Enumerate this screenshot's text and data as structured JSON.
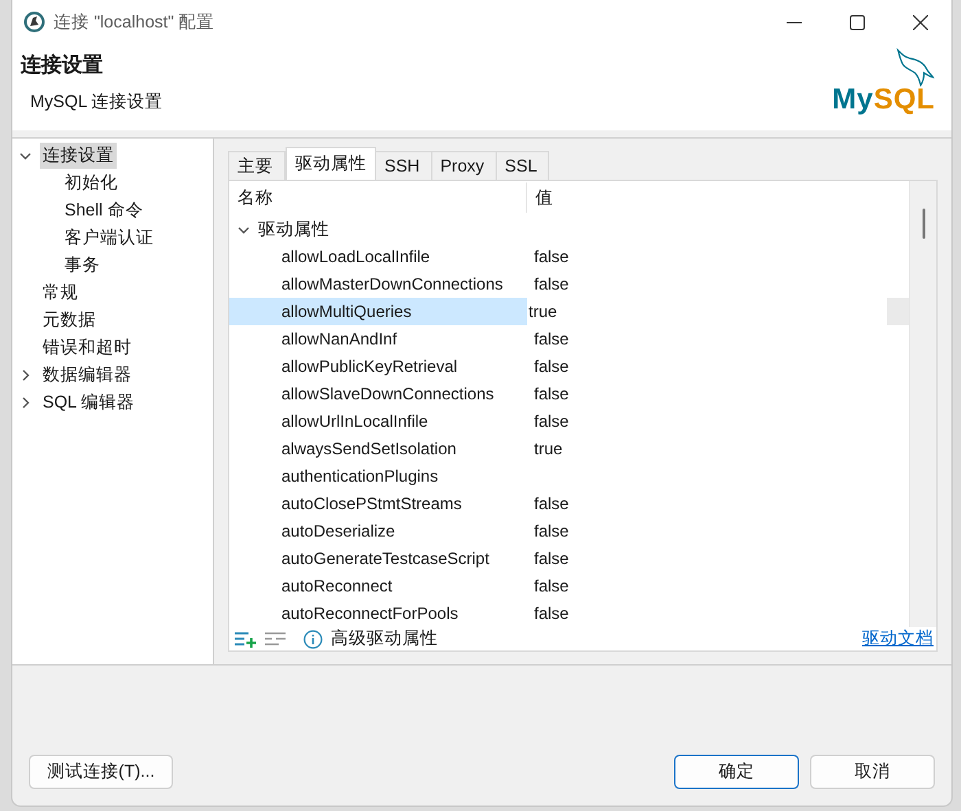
{
  "window": {
    "title": "连接 \"localhost\" 配置"
  },
  "header": {
    "title": "连接设置",
    "subtitle": "MySQL 连接设置",
    "logo": [
      "My",
      "SQL"
    ]
  },
  "sidebar": {
    "items": [
      {
        "label": "连接设置",
        "selected": true,
        "expanded": true,
        "children": [
          {
            "label": "初始化",
            "selected": false
          },
          {
            "label": "Shell 命令",
            "selected": false
          },
          {
            "label": "客户端认证",
            "selected": false
          },
          {
            "label": "事务",
            "selected": false
          }
        ]
      },
      {
        "label": "常规",
        "selected": false
      },
      {
        "label": "元数据",
        "selected": false
      },
      {
        "label": "错误和超时",
        "selected": false
      },
      {
        "label": "数据编辑器",
        "selected": false,
        "expanded": false
      },
      {
        "label": "SQL 编辑器",
        "selected": false,
        "expanded": false
      }
    ]
  },
  "tabs": [
    {
      "label": "主要",
      "selected": false
    },
    {
      "label": "驱动属性",
      "selected": true
    },
    {
      "label": "SSH",
      "selected": false
    },
    {
      "label": "Proxy",
      "selected": false
    },
    {
      "label": "SSL",
      "selected": false
    }
  ],
  "table": {
    "columns": [
      "名称",
      "值"
    ],
    "group": {
      "label": "驱动属性",
      "expanded": true,
      "rows": [
        {
          "name": "allowLoadLocalInfile",
          "value": "false",
          "selected": false
        },
        {
          "name": "allowMasterDownConnections",
          "value": "false",
          "selected": false
        },
        {
          "name": "allowMultiQueries",
          "value": "true",
          "selected": true
        },
        {
          "name": "allowNanAndInf",
          "value": "false",
          "selected": false
        },
        {
          "name": "allowPublicKeyRetrieval",
          "value": "false",
          "selected": false
        },
        {
          "name": "allowSlaveDownConnections",
          "value": "false",
          "selected": false
        },
        {
          "name": "allowUrlInLocalInfile",
          "value": "false",
          "selected": false
        },
        {
          "name": "alwaysSendSetIsolation",
          "value": "true",
          "selected": false
        },
        {
          "name": "authenticationPlugins",
          "selected": false
        },
        {
          "name": "autoClosePStmtStreams",
          "value": "false",
          "selected": false
        },
        {
          "name": "autoDeserialize",
          "value": "false",
          "selected": false
        },
        {
          "name": "autoGenerateTestcaseScript",
          "value": "false",
          "selected": false
        },
        {
          "name": "autoReconnect",
          "value": "false",
          "selected": false
        },
        {
          "name": "autoReconnectForPools",
          "value": "false",
          "selected": false
        }
      ]
    },
    "footer": {
      "info": "高级驱动属性",
      "link": "驱动文档"
    }
  },
  "buttons": [
    {
      "label": "测试连接(T)...",
      "kind": "secondary"
    },
    {
      "label": "确定",
      "kind": "default"
    },
    {
      "label": "取消",
      "kind": "normal"
    }
  ]
}
